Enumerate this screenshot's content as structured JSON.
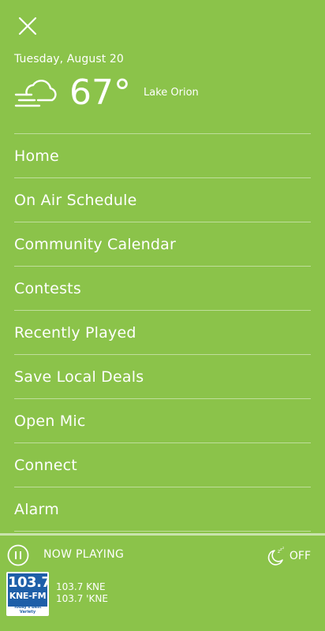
{
  "header": {
    "close_icon": "close-icon",
    "date": "Tuesday, August 20",
    "weather": {
      "icon": "cloudy-fog-icon",
      "temperature": "67°",
      "location": "Lake Orion"
    }
  },
  "menu": {
    "items": [
      {
        "label": "Home"
      },
      {
        "label": "On Air Schedule"
      },
      {
        "label": "Community Calendar"
      },
      {
        "label": "Contests"
      },
      {
        "label": "Recently Played"
      },
      {
        "label": "Save Local Deals"
      },
      {
        "label": "Open Mic"
      },
      {
        "label": "Connect"
      },
      {
        "label": "Alarm"
      }
    ]
  },
  "player": {
    "pause_icon": "pause-icon",
    "now_playing_label": "NOW PLAYING",
    "sleep_icon": "sleep-timer-icon",
    "sleep_label": "OFF",
    "station": {
      "logo": {
        "frequency": "103.7",
        "callsign": "KNE-FM",
        "tagline": "Today's Best Variety"
      },
      "line1": "103.7 KNE",
      "line2": "103.7 'KNE"
    }
  },
  "colors": {
    "background": "#8bc34a",
    "text": "#ffffff",
    "logo_blue": "#1e5fa8"
  }
}
